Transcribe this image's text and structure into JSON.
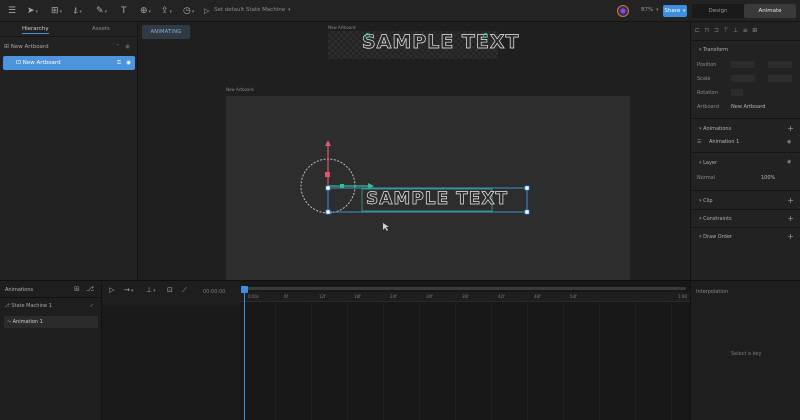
{
  "toolbar": {
    "state_machine_label": "Set default State Machine",
    "zoom": "87%",
    "share_label": "Share",
    "modes": [
      "Design",
      "Animate"
    ],
    "active_mode": "Animate"
  },
  "left_panel": {
    "tabs": [
      "Hierarchy",
      "Assets"
    ],
    "tree": [
      "New Artboard",
      "New Artboard"
    ]
  },
  "canvas": {
    "badge": "ANIMATING",
    "top_artboard_label": "New Artboard",
    "artboard_label": "New Artboard",
    "sample_text_top": "SAMPLE TEXT",
    "sample_text_main": "SAMPLE TEXT"
  },
  "right_panel": {
    "transform_title": "Transform",
    "position_label": "Position",
    "scale_label": "Scale",
    "rotation_label": "Rotation",
    "artboard_label": "Artboard",
    "artboard_value": "New Artboard",
    "animations_title": "Animations",
    "animation_item": "Animation 1",
    "layer_title": "Layer",
    "blend_value": "Normal",
    "opacity_value": "100%",
    "clip_title": "Clip",
    "constraints_title": "Constraints",
    "draw_order_title": "Draw Order"
  },
  "bottom": {
    "animations_title": "Animations",
    "state_machine_item": "State Machine 1",
    "animation_item": "Animation 1",
    "time_display": "00:00:00",
    "ticks": [
      "0:00s",
      "6f",
      "12f",
      "18f",
      "24f",
      "30f",
      "36f",
      "42f",
      "48f",
      "54f",
      "1:00"
    ],
    "interpolation_title": "Interpolation",
    "interpolation_empty": "Select a key"
  },
  "colors": {
    "accent": "#3f8fe0",
    "selection": "#4c94dc",
    "panel": "#222222",
    "canvas": "#1f1f1f",
    "artboard": "#2d2d2d",
    "y_axis": "#d9576b",
    "x_axis": "#33c08a"
  }
}
